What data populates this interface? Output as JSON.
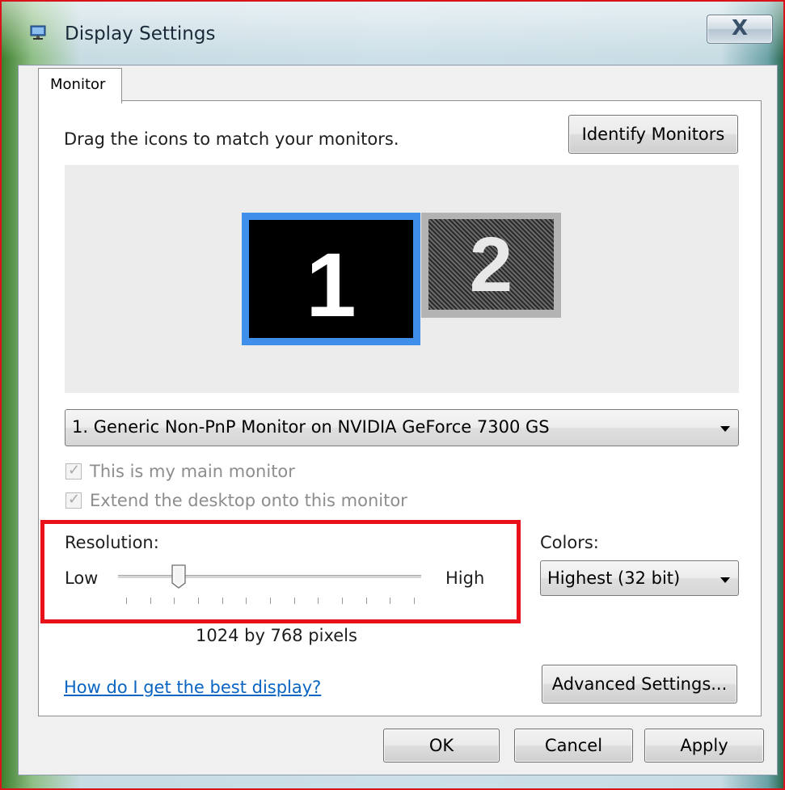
{
  "window": {
    "title": "Display Settings",
    "close_glyph": "X"
  },
  "tabs": [
    {
      "label": "Monitor",
      "selected": true
    }
  ],
  "monitor_tab": {
    "instruction": "Drag the icons to match your monitors.",
    "identify_button": "Identify Monitors",
    "monitors": [
      {
        "number": "1",
        "selected": true
      },
      {
        "number": "2",
        "selected": false
      }
    ],
    "monitor_select": {
      "selected": "1. Generic Non-PnP Monitor on NVIDIA GeForce 7300 GS"
    },
    "checkboxes": [
      {
        "label": "This is my main monitor",
        "checked": true,
        "disabled": true
      },
      {
        "label": "Extend the desktop onto this monitor",
        "checked": true,
        "disabled": true
      }
    ],
    "resolution": {
      "label": "Resolution:",
      "low_label": "Low",
      "high_label": "High",
      "value_text": "1024 by 768 pixels",
      "slider_position": 0.2,
      "tick_count": 13
    },
    "colors": {
      "label": "Colors:",
      "selected": "Highest (32 bit)"
    },
    "help_link": "How do I get the best display?",
    "advanced_button": "Advanced Settings..."
  },
  "footer": {
    "ok": "OK",
    "cancel": "Cancel",
    "apply": "Apply"
  },
  "colors_ui": {
    "highlight_border": "#e8111a",
    "selected_monitor_border": "#3f8ee9",
    "link": "#0a65c2"
  },
  "icons": {
    "app": "display-settings-icon",
    "close": "close-icon",
    "dropdown": "chevron-down-icon",
    "checkbox": "checkmark-icon"
  }
}
